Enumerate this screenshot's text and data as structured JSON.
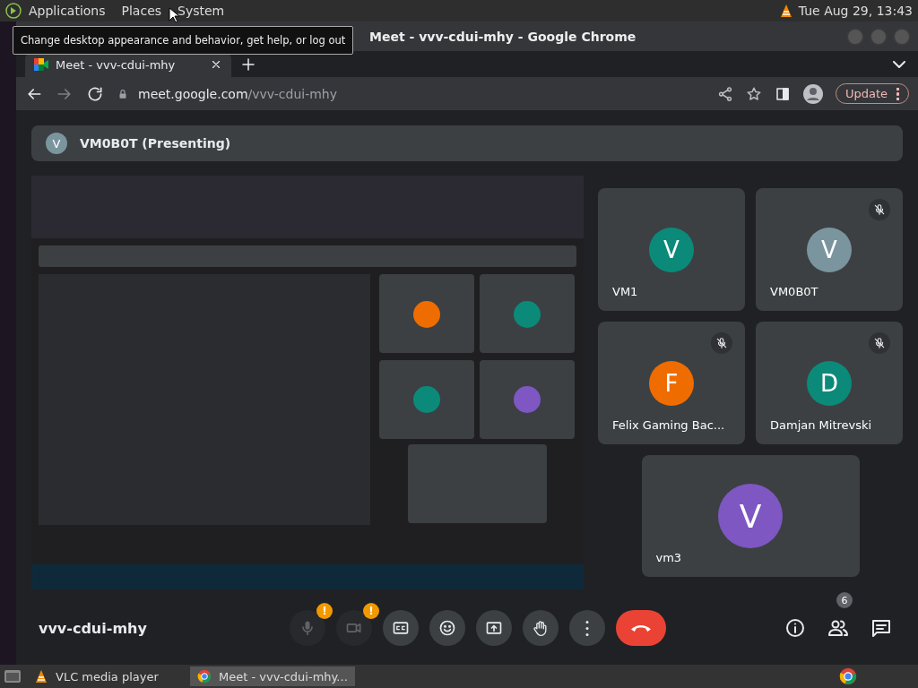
{
  "top_panel": {
    "menus": [
      "Applications",
      "Places",
      "System"
    ],
    "clock": "Tue Aug 29, 13:43"
  },
  "tooltip": "Change desktop appearance and behavior, get help, or log out",
  "browser": {
    "title": "Meet - vvv-cdui-mhy - Google Chrome",
    "tabs": [
      {
        "label": "Meet - vvv-cdui-mhy",
        "selected": true
      }
    ],
    "url_host": "meet.google.com",
    "url_path": "/vvv-cdui-mhy",
    "update_button": "Update"
  },
  "meet": {
    "presenter_initial": "V",
    "presenting_label": "VM0B0T (Presenting)",
    "participants": [
      {
        "name": "VM1",
        "initial": "V",
        "color": "#0b8a7a",
        "muted": false
      },
      {
        "name": "VM0B0T",
        "initial": "V",
        "color": "#7b959f",
        "muted": true
      },
      {
        "name": "Felix Gaming Bac...",
        "initial": "F",
        "color": "#ef6c00",
        "muted": true
      },
      {
        "name": "Damjan Mitrevski",
        "initial": "D",
        "color": "#0b8a7a",
        "muted": true
      },
      {
        "name": "vm3",
        "initial": "V",
        "color": "#7e57c2",
        "muted": false
      }
    ],
    "meeting_code": "vvv-cdui-mhy",
    "controls": [
      {
        "kind": "mic",
        "disabled": true,
        "badge": "!"
      },
      {
        "kind": "camera",
        "disabled": true,
        "badge": "!"
      },
      {
        "kind": "captions",
        "disabled": false
      },
      {
        "kind": "emoji",
        "disabled": false
      },
      {
        "kind": "present",
        "disabled": false
      },
      {
        "kind": "hand",
        "disabled": false
      },
      {
        "kind": "more",
        "disabled": false
      },
      {
        "kind": "hangup",
        "disabled": false
      }
    ],
    "side_controls": [
      {
        "kind": "info"
      },
      {
        "kind": "people",
        "badge": "6"
      },
      {
        "kind": "chat"
      }
    ]
  },
  "taskbar": [
    {
      "label": "VLC media player",
      "selected": false
    },
    {
      "label": "Meet - vvv-cdui-mhy...",
      "selected": true
    }
  ]
}
